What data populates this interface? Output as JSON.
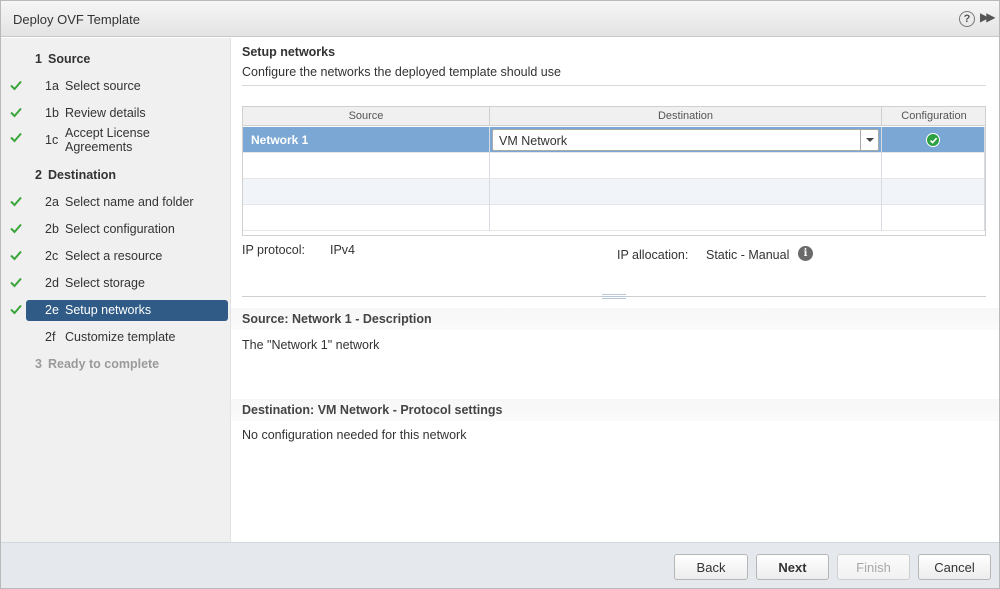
{
  "window": {
    "title": "Deploy OVF Template"
  },
  "steps": [
    {
      "num": "1",
      "label": "Source",
      "level": "header",
      "done": false,
      "active": false,
      "disabled": false
    },
    {
      "num": "1a",
      "label": "Select source",
      "level": "sub",
      "done": true,
      "active": false,
      "disabled": false
    },
    {
      "num": "1b",
      "label": "Review details",
      "level": "sub",
      "done": true,
      "active": false,
      "disabled": false
    },
    {
      "num": "1c",
      "label": "Accept License Agreements",
      "level": "sub",
      "done": true,
      "active": false,
      "disabled": false
    },
    {
      "num": "2",
      "label": "Destination",
      "level": "header",
      "done": false,
      "active": false,
      "disabled": false
    },
    {
      "num": "2a",
      "label": "Select name and folder",
      "level": "sub",
      "done": true,
      "active": false,
      "disabled": false
    },
    {
      "num": "2b",
      "label": "Select configuration",
      "level": "sub",
      "done": true,
      "active": false,
      "disabled": false
    },
    {
      "num": "2c",
      "label": "Select a resource",
      "level": "sub",
      "done": true,
      "active": false,
      "disabled": false
    },
    {
      "num": "2d",
      "label": "Select storage",
      "level": "sub",
      "done": true,
      "active": false,
      "disabled": false
    },
    {
      "num": "2e",
      "label": "Setup networks",
      "level": "sub",
      "done": true,
      "active": true,
      "disabled": false
    },
    {
      "num": "2f",
      "label": "Customize template",
      "level": "sub",
      "done": false,
      "active": false,
      "disabled": false
    },
    {
      "num": "3",
      "label": "Ready to complete",
      "level": "header",
      "done": false,
      "active": false,
      "disabled": true
    }
  ],
  "main": {
    "title": "Setup networks",
    "subtitle": "Configure the networks the deployed template should use",
    "table": {
      "columns": [
        "Source",
        "Destination",
        "Configuration"
      ],
      "rows": [
        {
          "source": "Network 1",
          "destination": "VM Network",
          "config_ok": true
        }
      ]
    },
    "ip_protocol_label": "IP protocol:",
    "ip_protocol_value": "IPv4",
    "ip_allocation_label": "IP allocation:",
    "ip_allocation_value": "Static - Manual",
    "source_desc_title": "Source: Network 1 - Description",
    "source_desc_text": "The \"Network 1\" network",
    "dest_title": "Destination: VM Network - Protocol settings",
    "dest_text": "No configuration needed for this network"
  },
  "buttons": {
    "back": "Back",
    "next": "Next",
    "finish": "Finish",
    "cancel": "Cancel"
  },
  "colors": {
    "accent": "#2f5b86",
    "selected_row": "#7aa7d3",
    "check": "#3aa63a"
  }
}
